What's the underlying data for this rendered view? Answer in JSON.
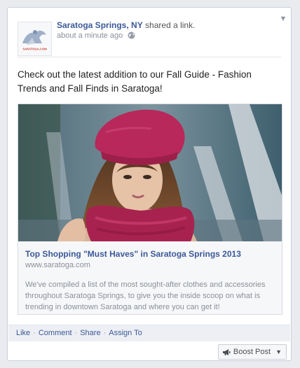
{
  "post": {
    "page_name": "Saratoga Springs, NY",
    "action_text": "shared a link.",
    "timestamp": "about a minute ago",
    "privacy_icon": "globe-icon",
    "avatar_logo_text": "SARATOGA.COM",
    "message": "Check out the latest addition to our Fall Guide - Fashion Trends and Fall Finds in Saratoga!"
  },
  "attachment": {
    "title": "Top Shopping \"Must Haves\" in Saratoga Springs 2013",
    "domain": "www.saratoga.com",
    "description": "We've compiled a list of the most sought-after clothes and accessories throughout Saratoga Springs, to give you the inside scoop on what is trending in downtown Saratoga and where you can get it!"
  },
  "actions": {
    "like": "Like",
    "comment": "Comment",
    "share": "Share",
    "assign": "Assign To",
    "separator": "·"
  },
  "boost": {
    "label": "Boost Post",
    "icon": "megaphone-icon"
  },
  "colors": {
    "link_blue": "#3b5998",
    "meta_gray": "#8a8f99",
    "hat_color": "#b8285a"
  }
}
